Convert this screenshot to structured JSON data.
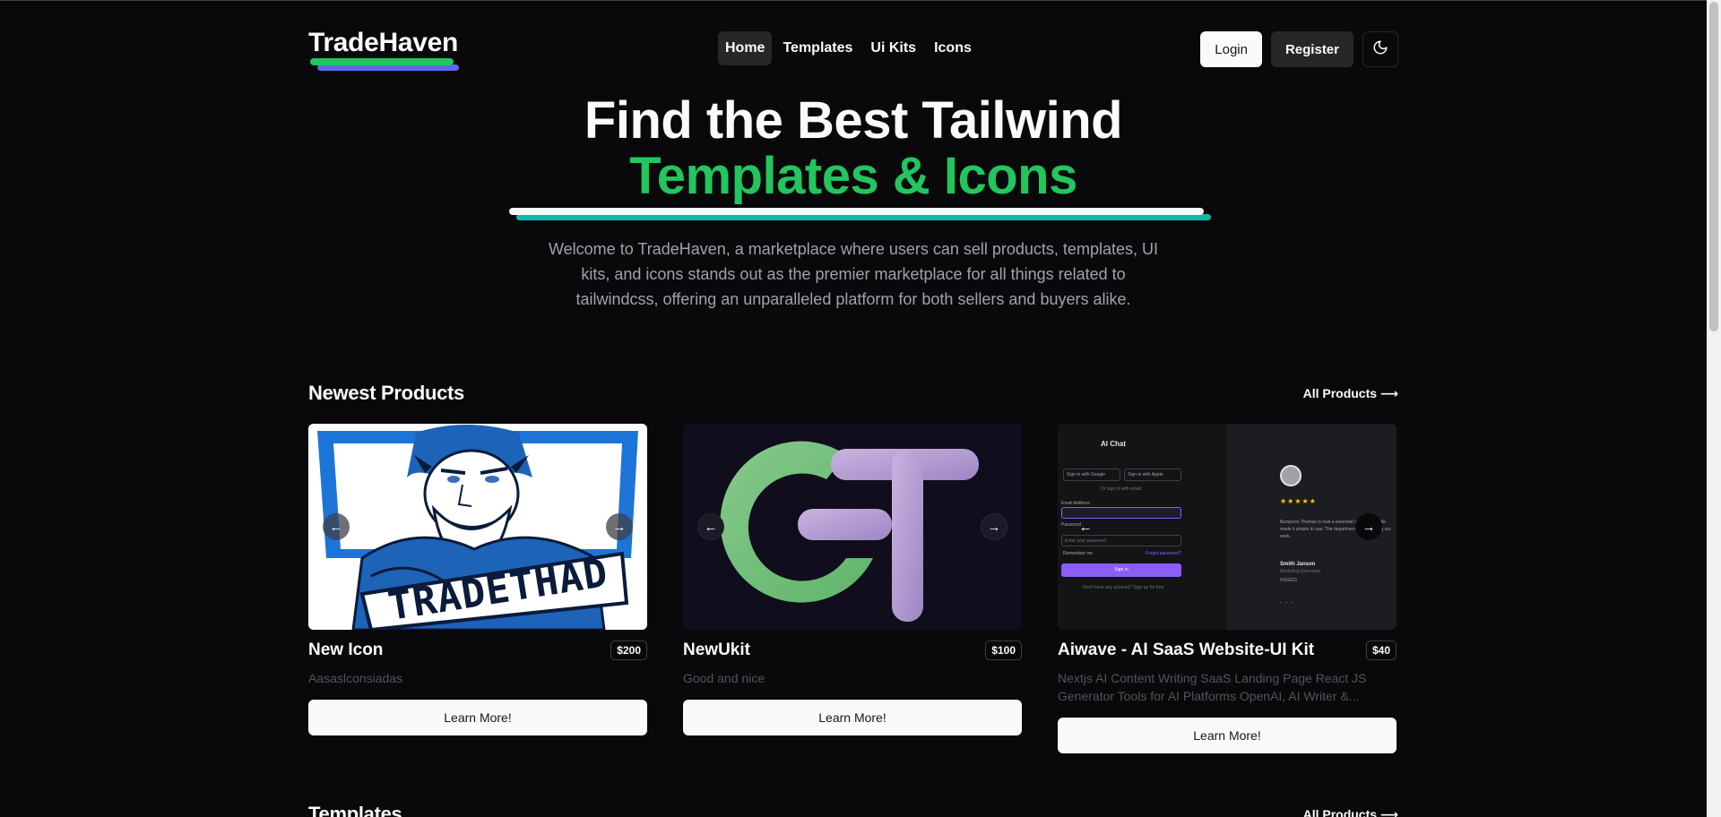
{
  "header": {
    "logo": "TradeHaven",
    "nav": [
      {
        "label": "Home",
        "active": true
      },
      {
        "label": "Templates",
        "active": false
      },
      {
        "label": "Ui Kits",
        "active": false
      },
      {
        "label": "Icons",
        "active": false
      }
    ],
    "login_label": "Login",
    "register_label": "Register",
    "theme_icon": "moon-icon"
  },
  "hero": {
    "title_line1": "Find the Best Tailwind",
    "title_line2": "Templates & Icons",
    "description": "Welcome to TradeHaven, a marketplace where users can sell products, templates, UI kits, and icons stands out as the premier marketplace for all things related to tailwindcss, offering an unparalleled platform for both sellers and buyers alike."
  },
  "newest": {
    "title": "Newest Products",
    "link": "All Products ⟶",
    "products": [
      {
        "title": "New Icon",
        "price": "$200",
        "description": "Aasaslconsiadas",
        "cta": "Learn More!"
      },
      {
        "title": "NewUkit",
        "price": "$100",
        "description": "Good and nice",
        "cta": "Learn More!"
      },
      {
        "title": "Aiwave - AI SaaS Website-UI Kit",
        "price": "$40",
        "description": "Nextjs AI Content Writing SaaS Landing Page React JS Generator Tools for AI Platforms OpenAI, AI Writer &...",
        "cta": "Learn More!"
      }
    ],
    "thumb1_text": "TRADETHAD",
    "thumb3": {
      "brand": "AI Chat",
      "google": "Sign in with Google",
      "apple": "Sign in with Apple",
      "or": "Or sign in with email",
      "email_label": "Email Address",
      "password_label": "Password",
      "password_placeholder": "Enter your password",
      "remember": "Remember me",
      "forgot": "Forgot password?",
      "signin": "Sign in",
      "noacct": "Don't have any account? Sign up for free",
      "quote": "Bumpoon Thomas is now a essential of our work! We made it simple to use. The departments by grouping our work.",
      "person": "Smith Janson",
      "role": "Marketing Executive",
      "company": "HUGGO"
    }
  },
  "templates": {
    "title": "Templates",
    "link": "All Products ⟶"
  },
  "colors": {
    "background": "#09090b",
    "accent_green": "#22c55e",
    "accent_teal": "#14b8a6",
    "accent_indigo": "#6366f1",
    "muted": "#a1a1aa"
  }
}
